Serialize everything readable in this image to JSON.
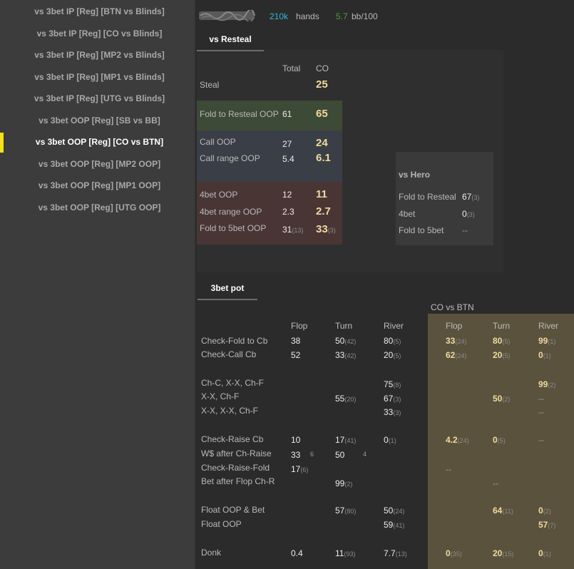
{
  "sidebar": {
    "items": [
      {
        "label": "vs 3bet IP [Reg] [BTN vs Blinds]"
      },
      {
        "label": "vs 3bet IP [Reg] [CO vs Blinds]"
      },
      {
        "label": "vs 3bet IP [Reg] [MP2 vs Blinds]"
      },
      {
        "label": "vs 3bet IP [Reg] [MP1 vs Blinds]"
      },
      {
        "label": "vs 3bet IP [Reg] [UTG vs Blinds]"
      },
      {
        "label": "vs 3bet OOP [Reg] [SB vs BB]"
      },
      {
        "label": "vs 3bet OOP [Reg] [CO vs BTN]"
      },
      {
        "label": "vs 3bet OOP [Reg] [MP2 OOP]"
      },
      {
        "label": "vs 3bet OOP [Reg] [MP1 OOP]"
      },
      {
        "label": "vs 3bet OOP [Reg] [UTG OOP]"
      }
    ],
    "active_index": 6
  },
  "header": {
    "hands_value": "210k",
    "hands_label": "hands",
    "bb_value": "5.7",
    "bb_label": "bb/100"
  },
  "colors": {
    "hands_value": "#31b9d6",
    "bb_value": "#4f9a3a",
    "marker": "#f3e11b",
    "gold_text": "#f1d9a0"
  },
  "resteal": {
    "tab_label": "vs Resteal",
    "col_total": "Total",
    "col_co": "CO",
    "rows": {
      "steal": {
        "label": "Steal",
        "co": "25"
      },
      "fold_to_resteal": {
        "label": "Fold to Resteal OOP",
        "total": "61",
        "co": "65"
      },
      "call_oop": {
        "label": "Call OOP",
        "total": "27",
        "co": "24"
      },
      "call_range": {
        "label": "Call range OOP",
        "total": "5.4",
        "co": "6.1"
      },
      "fourbet": {
        "label": "4bet OOP",
        "total": "12",
        "co": "11"
      },
      "fourbet_range": {
        "label": "4bet range OOP",
        "total": "2.3",
        "co": "2.7"
      },
      "fold_5bet": {
        "label": "Fold to 5bet OOP",
        "total": "31",
        "total_n": "(13)",
        "co": "33",
        "co_n": "(3)"
      }
    },
    "vs_hero": {
      "title": "vs Hero",
      "fold_to_resteal": {
        "label": "Fold to Resteal",
        "value": "67",
        "n": "(3)"
      },
      "fourbet": {
        "label": "4bet",
        "value": "0",
        "n": "(3)"
      },
      "fold_5bet": {
        "label": "Fold to 5bet",
        "value": "--"
      }
    }
  },
  "threebet": {
    "tab_label": "3bet pot",
    "group_header": "CO vs BTN",
    "cols": {
      "flop": "Flop",
      "turn": "Turn",
      "river": "River",
      "flop2": "Flop",
      "turn2": "Turn",
      "river2": "River"
    },
    "labels": {
      "check_fold_cb": "Check-Fold to Cb",
      "check_call_cb": "Check-Call Cb",
      "chc_xx_chf": "Ch-C, X-X, Ch-F",
      "xx_chf": "X-X, Ch-F",
      "xx_xx_chf": "X-X, X-X, Ch-F",
      "check_raise_cb": "Check-Raise Cb",
      "ws_after_chr": "W$ after Ch-Raise",
      "check_raise_fold": "Check-Raise-Fold",
      "bet_after_flop_chr": "Bet after Flop Ch-R",
      "float_oop_bet": "Float OOP & Bet",
      "float_oop": "Float OOP",
      "donk": "Donk"
    },
    "v": {
      "cf_flop": "38",
      "cf_turn": "50",
      "cf_turn_n": "(42)",
      "cf_river": "80",
      "cf_river_n": "(5)",
      "cf_g_flop": "33",
      "cf_g_flop_n": "(24)",
      "cf_g_turn": "80",
      "cf_g_turn_n": "(5)",
      "cf_g_river": "99",
      "cf_g_river_n": "(1)",
      "cc_flop": "52",
      "cc_turn": "33",
      "cc_turn_n": "(42)",
      "cc_river": "20",
      "cc_river_n": "(5)",
      "cc_g_flop": "62",
      "cc_g_flop_n": "(24)",
      "cc_g_turn": "20",
      "cc_g_turn_n": "(5)",
      "cc_g_river": "0",
      "cc_g_river_n": "(1)",
      "chc_river": "75",
      "chc_river_n": "(8)",
      "chc_g_river": "99",
      "chc_g_river_n": "(2)",
      "xx_turn": "55",
      "xx_turn_n": "(20)",
      "xx_river": "67",
      "xx_river_n": "(3)",
      "xx_g_turn": "50",
      "xx_g_turn_n": "(2)",
      "xx_g_river": "--",
      "xxx_river": "33",
      "xxx_river_n": "(3)",
      "xxx_g_river": "--",
      "cr_flop": "10",
      "cr_turn": "17",
      "cr_turn_n": "(41)",
      "cr_river": "0",
      "cr_river_n": "(1)",
      "cr_g_flop": "4.2",
      "cr_g_flop_n": "(24)",
      "cr_g_turn": "0",
      "cr_g_turn_n": "(5)",
      "cr_g_river": "--",
      "ws_flop": "33",
      "ws_flop_n": "6",
      "ws_turn": "50",
      "ws_turn_n": "4",
      "crf_flop": "17",
      "crf_flop_n": "(6)",
      "crf_g_flop": "--",
      "bafc_turn": "99",
      "bafc_turn_n": "(2)",
      "bafc_g_turn": "--",
      "fob_turn": "57",
      "fob_turn_n": "(80)",
      "fob_river": "50",
      "fob_river_n": "(24)",
      "fob_g_turn": "64",
      "fob_g_turn_n": "(11)",
      "fob_g_river": "0",
      "fob_g_river_n": "(2)",
      "fo_river": "59",
      "fo_river_n": "(41)",
      "fo_g_river": "57",
      "fo_g_river_n": "(7)",
      "donk_flop": "0.4",
      "donk_turn": "11",
      "donk_turn_n": "(93)",
      "donk_river": "7.7",
      "donk_river_n": "(13)",
      "donk_g_flop": "0",
      "donk_g_flop_n": "(35)",
      "donk_g_turn": "20",
      "donk_g_turn_n": "(15)",
      "donk_g_river": "0",
      "donk_g_river_n": "(1)"
    }
  }
}
